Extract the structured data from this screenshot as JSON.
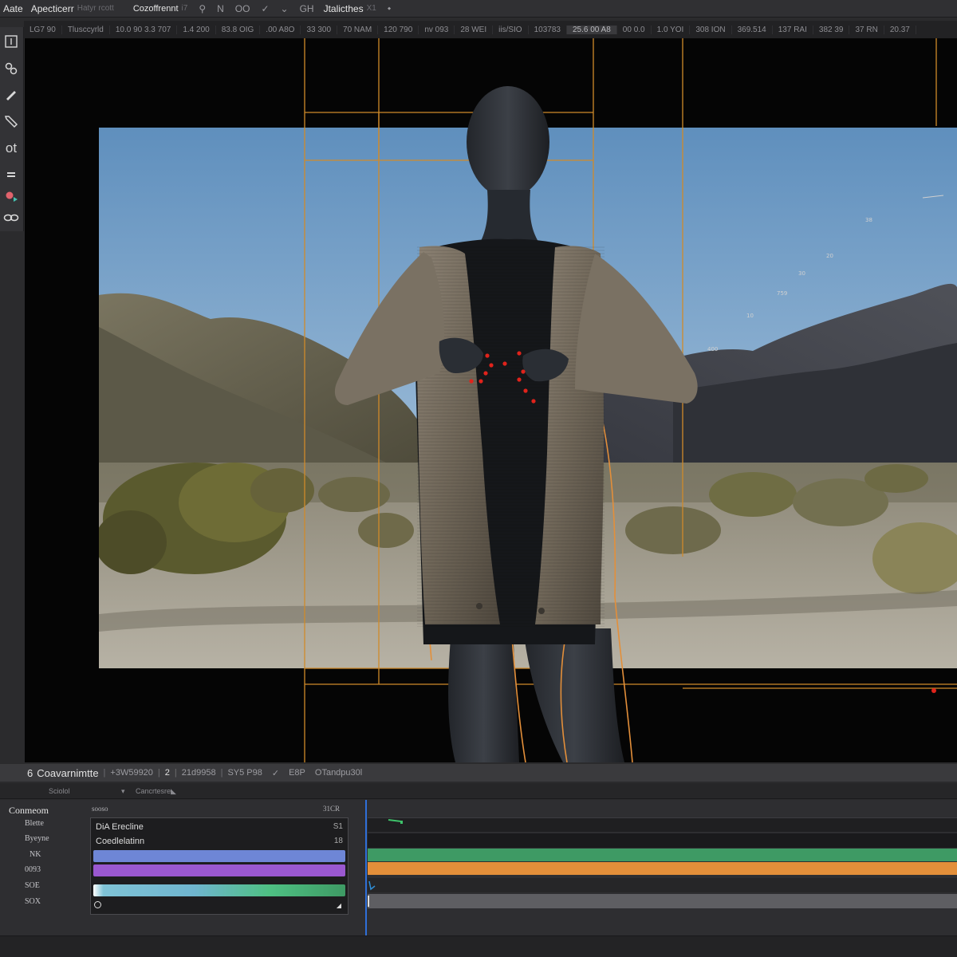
{
  "menubar": {
    "app_name": "Aate",
    "menu_a": "Apecticerr",
    "menu_a_sub": "Hatyr rcott",
    "menu_b": "Cozoffrennt",
    "menu_b_sub": "i7",
    "icon_key": "⚲",
    "menu_n": "N",
    "menu_oo": "OO",
    "menu_check": "✓",
    "menu_down": "⌄",
    "menu_gh": "GH",
    "menu_c": "Jtalicthes",
    "menu_c_sub": "X1",
    "menu_arrow": "⬩"
  },
  "infobar": {
    "cells": [
      "LG7 90",
      "Tlusccyrld",
      "10.0 90 3.3 707",
      "1.4 200",
      "83.8 OIG",
      ".00 A8O",
      "33 300",
      "70 NAM",
      "120 790",
      "nv 093",
      "28 WEI",
      "iis/SIO",
      "103783",
      "25.6 00 A8",
      "00 0.0",
      "1.0 YOI",
      "308 ION",
      "369.514",
      "137 RAI",
      "382 39",
      "37 RN",
      "20.37"
    ]
  },
  "toolbar": {
    "tools": [
      "frame-tool",
      "link-tool",
      "brush-tool",
      "pen-tool",
      "text-tool",
      "adjust-tool",
      "color-tool",
      "loop-tool"
    ],
    "text_tool_label": "ot"
  },
  "viewport": {
    "scale_labels": [
      "38",
      "20",
      "30",
      "759",
      "10",
      "400"
    ]
  },
  "statusbar": {
    "index": "6",
    "title": "Coavarnimtte",
    "v1": "+3W59920",
    "v2": "2",
    "v3": "21d9958",
    "v4": "SY5 P98",
    "check": "✓",
    "v5": "E8P",
    "v6": "OTandpu30l"
  },
  "timeline_header": {
    "left": "Sciolol",
    "right": "Cancrtesre"
  },
  "timeline": {
    "section_title": "Conmeom",
    "column_header": "sooso",
    "column_header_right": "31CR",
    "track_labels": [
      "Blette",
      "Byeyne",
      "NK",
      "0093",
      "SOE",
      "SOX"
    ],
    "list_rows": [
      {
        "name": "DiA Erecline",
        "num": "S1"
      },
      {
        "name": "Coedlelatinn",
        "num": "18"
      }
    ],
    "colors": {
      "bar_blue": "#6e86d6",
      "bar_purple": "#9a58d0",
      "lane_green": "#3e9a64",
      "lane_orange": "#e38f3a",
      "gradient_cyan": "#7fc3d6",
      "accent_guide": "#d08a2a"
    }
  }
}
